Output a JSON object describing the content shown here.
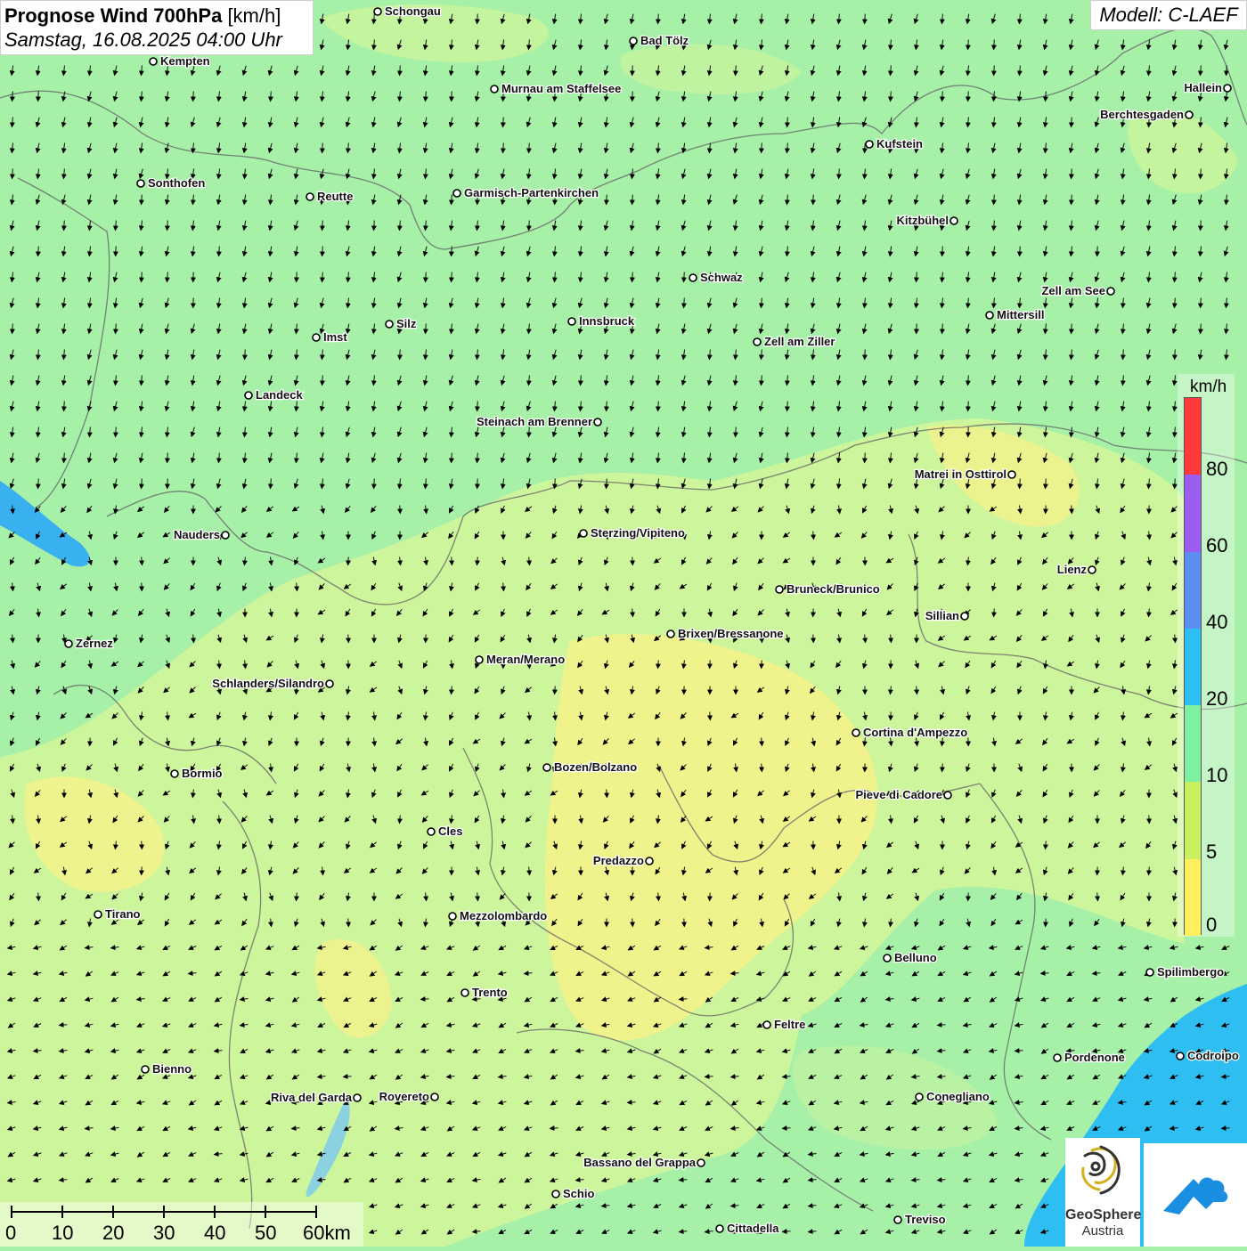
{
  "title": {
    "main": "Prognose Wind 700hPa",
    "unit": "[km/h]",
    "datetime": "Samstag, 16.08.2025 04:00 Uhr"
  },
  "model": "Modell: C-LAEF",
  "legend": {
    "unit": "km/h",
    "ticks": [
      "80",
      "60",
      "40",
      "20",
      "10",
      "5",
      "0"
    ],
    "colors": [
      "#ff3a3a",
      "#9b5cf0",
      "#5b8ef0",
      "#2ebff2",
      "#7ef0a0",
      "#c8f060",
      "#fff060"
    ]
  },
  "scale": {
    "labels": [
      "0",
      "10",
      "20",
      "30",
      "40",
      "50",
      "60km"
    ]
  },
  "logo": {
    "line1": "GeoSphere",
    "line2": "Austria"
  },
  "cities": [
    {
      "name": "Schongau"
    },
    {
      "name": "Bad Tölz"
    },
    {
      "name": "Kempten"
    },
    {
      "name": "Murnau am Staffelsee"
    },
    {
      "name": "Hallein"
    },
    {
      "name": "Berchtesgaden"
    },
    {
      "name": "Kufstein"
    },
    {
      "name": "Sonthofen"
    },
    {
      "name": "Reutte"
    },
    {
      "name": "Garmisch-Partenkirchen"
    },
    {
      "name": "Kitzbühel"
    },
    {
      "name": "Schwaz"
    },
    {
      "name": "Zell am See"
    },
    {
      "name": "Mittersill"
    },
    {
      "name": "Silz"
    },
    {
      "name": "Innsbruck"
    },
    {
      "name": "Imst"
    },
    {
      "name": "Zell am Ziller"
    },
    {
      "name": "Landeck"
    },
    {
      "name": "Steinach am Brenner"
    },
    {
      "name": "Matrei in Osttirol"
    },
    {
      "name": "Nauders"
    },
    {
      "name": "Sterzing/Vipiteno"
    },
    {
      "name": "Lienz"
    },
    {
      "name": "Bruneck/Brunico"
    },
    {
      "name": "Sillian"
    },
    {
      "name": "Zernez"
    },
    {
      "name": "Brixen/Bressanone"
    },
    {
      "name": "Meran/Merano"
    },
    {
      "name": "Schlanders/Silandro"
    },
    {
      "name": "Cortina d'Ampezzo"
    },
    {
      "name": "Bozen/Bolzano"
    },
    {
      "name": "Bormio"
    },
    {
      "name": "Pieve di Cadore"
    },
    {
      "name": "Cles"
    },
    {
      "name": "Predazzo"
    },
    {
      "name": "Tirano"
    },
    {
      "name": "Mezzolombardo"
    },
    {
      "name": "Belluno"
    },
    {
      "name": "Spilimbergo"
    },
    {
      "name": "Trento"
    },
    {
      "name": "Feltre"
    },
    {
      "name": "Pordenone"
    },
    {
      "name": "Codroipo"
    },
    {
      "name": "Bienno"
    },
    {
      "name": "Riva del Garda"
    },
    {
      "name": "Rovereto"
    },
    {
      "name": "Conegliano"
    },
    {
      "name": "Bassano del Grappa"
    },
    {
      "name": "Schio"
    },
    {
      "name": "Treviso"
    },
    {
      "name": "Cittadella"
    }
  ]
}
